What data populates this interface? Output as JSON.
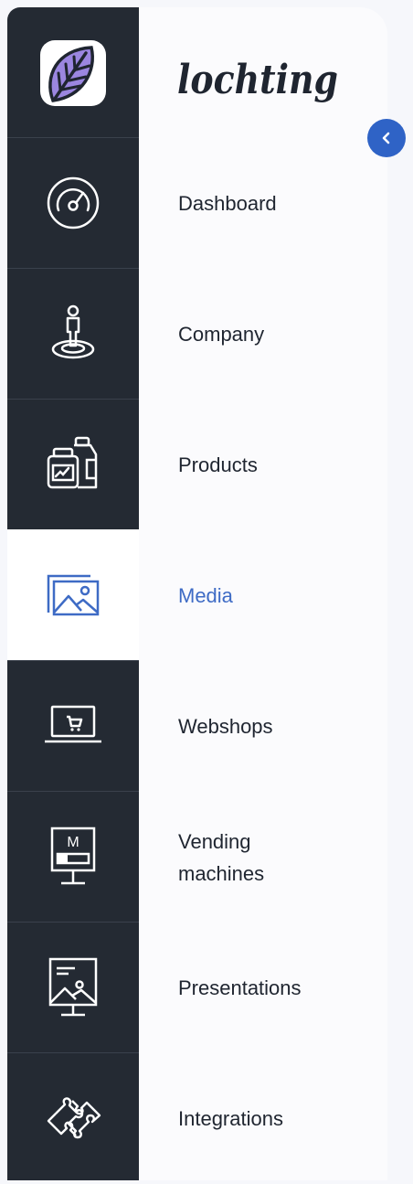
{
  "brand": {
    "logo_text": "lochting"
  },
  "collapse_button": {
    "icon": "chevron-left-icon"
  },
  "nav": {
    "items": [
      {
        "label": "Dashboard",
        "icon": "speedometer-icon",
        "active": false
      },
      {
        "label": "Company",
        "icon": "person-location-icon",
        "active": false
      },
      {
        "label": "Products",
        "icon": "product-bottles-icon",
        "active": false
      },
      {
        "label": "Media",
        "icon": "image-gallery-icon",
        "active": true
      },
      {
        "label": "Webshops",
        "icon": "laptop-cart-icon",
        "active": false
      },
      {
        "label": "Vending\nmachines",
        "icon": "vending-machine-icon",
        "active": false
      },
      {
        "label": "Presentations",
        "icon": "presentation-screen-icon",
        "active": false
      },
      {
        "label": "Integrations",
        "icon": "puzzle-icon",
        "active": false
      }
    ]
  },
  "colors": {
    "rail_bg": "#242a33",
    "panel_bg": "#fbfbfd",
    "accent": "#3e6bc5",
    "collapse_bg": "#2f63c6",
    "logo_leaf": "#9b86e0"
  }
}
